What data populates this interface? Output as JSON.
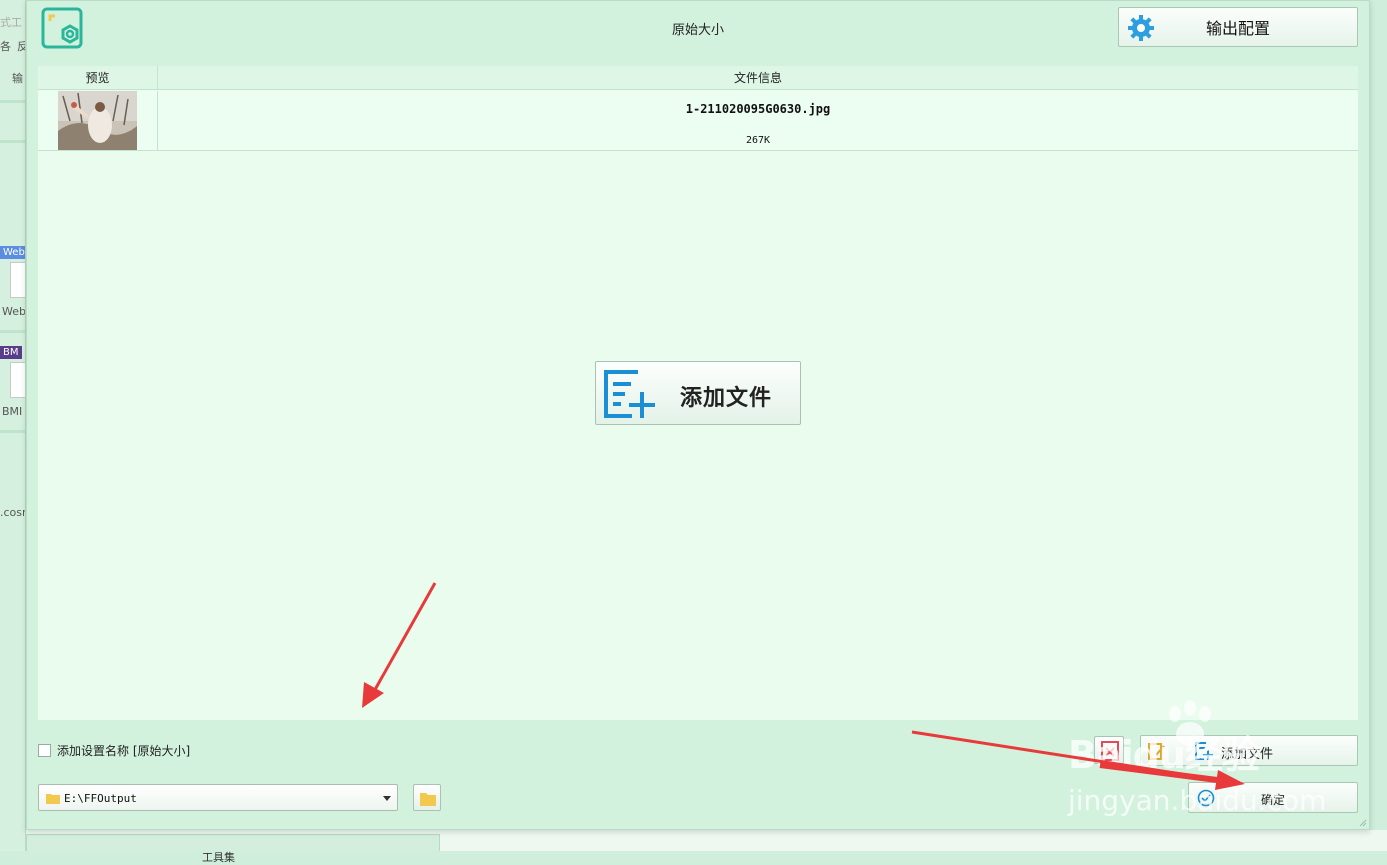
{
  "background_window": {
    "fragments": [
      "式工",
      "各",
      "反",
      "输",
      "Web",
      "Web",
      "BM",
      "BMI",
      ".cosm"
    ],
    "bottom_tab_label": "工具集"
  },
  "dialog": {
    "title": "原始大小",
    "output_config_label": "输出配置",
    "list": {
      "columns": [
        "预览",
        "文件信息"
      ],
      "rows": [
        {
          "file_name": "1-211020095G0630.jpg",
          "file_size": "267K"
        }
      ]
    },
    "add_file_big_label": "添加文件",
    "add_setting_name_label": "添加设置名称 [原始大小]",
    "add_setting_name_checked": false,
    "add_file_small_label": "添加文件",
    "ok_label": "确定",
    "output_path": "E:\\FFOutput"
  },
  "watermark": {
    "brand": "Baidu经验",
    "site": "jingyan.baidu.com"
  },
  "colors": {
    "accent_teal": "#2bb59a",
    "accent_blue": "#1b8fd6",
    "annotation_red": "#e83a3a"
  }
}
